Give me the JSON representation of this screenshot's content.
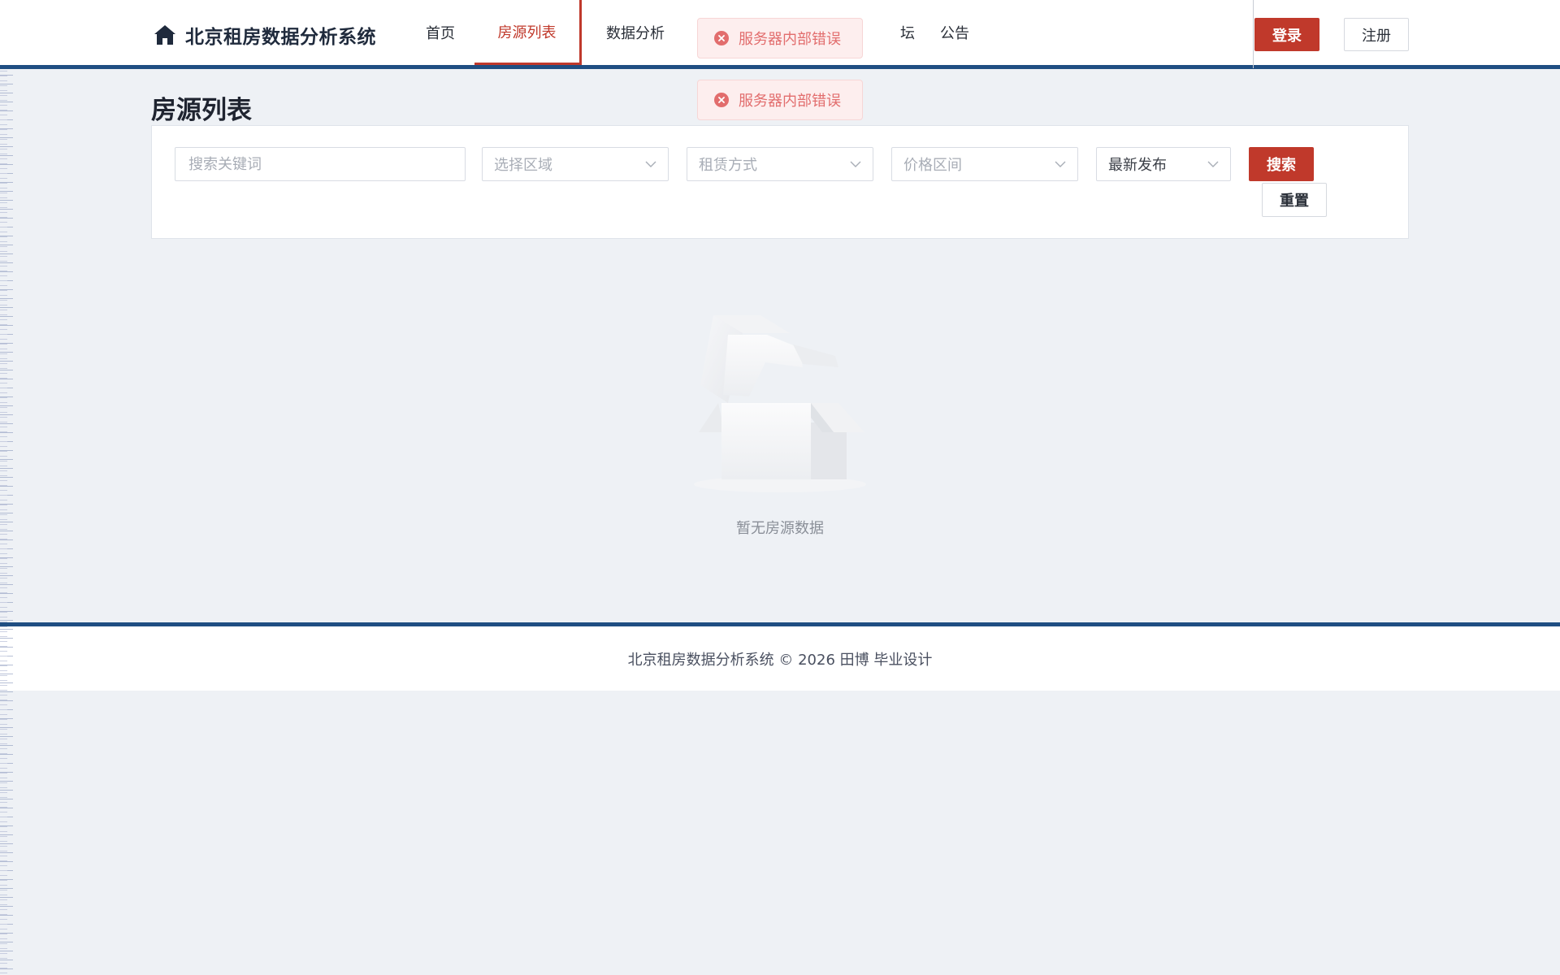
{
  "header": {
    "brand_title": "北京租房数据分析系统",
    "nav": [
      {
        "label": "首页"
      },
      {
        "label": "房源列表"
      },
      {
        "label": "数据分析"
      },
      {
        "label": "坛"
      },
      {
        "label": "公告"
      }
    ],
    "active_nav": "房源列表",
    "login_label": "登录",
    "register_label": "注册"
  },
  "toasts": [
    {
      "message": "服务器内部错误"
    },
    {
      "message": "服务器内部错误"
    }
  ],
  "page": {
    "title": "房源列表"
  },
  "filters": {
    "keyword_placeholder": "搜索关键词",
    "region_placeholder": "选择区域",
    "rent_type_placeholder": "租赁方式",
    "price_placeholder": "价格区间",
    "sort_selected": "最新发布",
    "search_label": "搜索",
    "reset_label": "重置"
  },
  "empty_state": {
    "text": "暂无房源数据"
  },
  "footer": {
    "text": "北京租房数据分析系统 © 2026 田博 毕业设计"
  },
  "colors": {
    "accent": "#c0392b",
    "header_border": "#1f4e82",
    "background": "#eef1f5",
    "toast_text": "#e26d6d",
    "toast_bg": "#fdeeee"
  }
}
